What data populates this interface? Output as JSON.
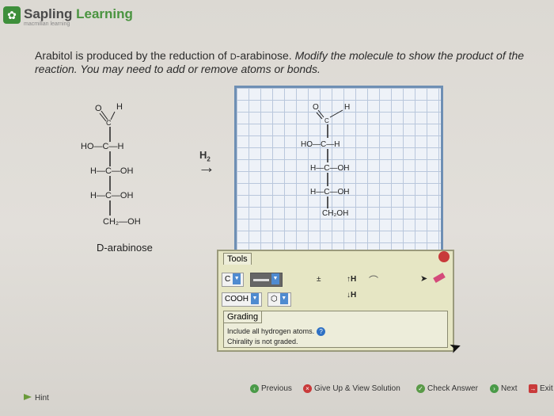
{
  "brand": {
    "name_a": "Sapling",
    "name_b": "Learning",
    "sub": "macmillan learning"
  },
  "question": {
    "line_a": "Arabitol is produced by the reduction of ",
    "small_d": "D",
    "line_b": "-arabinose. ",
    "line_c": "Modify the molecule to show the product of the reaction. You may need to add or remove atoms or bonds."
  },
  "reactant": {
    "name": "D-arabinose",
    "o": "O",
    "h": "H",
    "c": "C",
    "row1": "HO—C—H",
    "row2": "H—C—OH",
    "row3": "H—C—OH",
    "row4": "CH₂—OH"
  },
  "reagent": {
    "h2": "H",
    "sub2": "2",
    "arrow": "→"
  },
  "editor": {
    "o": "O",
    "h": "H",
    "c": "C",
    "row1": "HO—C—H",
    "row2": "H—C—OH",
    "row3": "H—C—OH",
    "row4": "CH₂OH"
  },
  "tools": {
    "title": "Tools",
    "atom": "C",
    "charge": "±",
    "h_up": "↑H",
    "h_down": "↓H",
    "cooh": "COOH",
    "grading_title": "Grading",
    "grading_line1": "Include all hydrogen atoms.",
    "grading_line2": "Chirality is not graded."
  },
  "nav": {
    "previous": "Previous",
    "give_up": "Give Up & View Solution",
    "check": "Check Answer",
    "next": "Next",
    "exit": "Exit",
    "hint": "Hint"
  },
  "colors": {
    "accent_green": "#4a9440",
    "canvas_border": "#6e8fb4",
    "tool_panel": "#e6e6c4"
  }
}
